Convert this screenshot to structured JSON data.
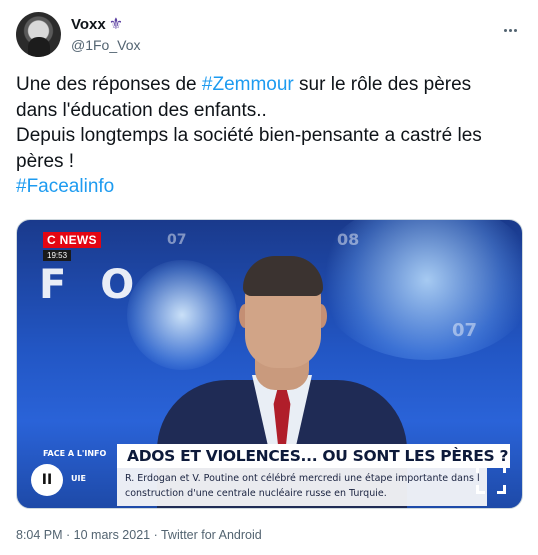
{
  "author": {
    "display_name": "Voxx",
    "badge_glyph": "⚜",
    "handle": "@1Fo_Vox",
    "avatar_icon": "profile-avatar"
  },
  "more_icon": "more-horizontal-icon",
  "tweet": {
    "line1_prefix": "Une des réponses de ",
    "line1_hashtag": "#Zemmour",
    "line1_suffix": " sur le rôle des pères",
    "line2": "dans l'éducation des enfants..",
    "line3": "Depuis longtemps la société bien-pensante a castré les",
    "line4": "pères !",
    "line5_hashtag": "#Facealinfo"
  },
  "media": {
    "channel_logo": "C NEWS",
    "clock": "19:53",
    "bg_text": "F O",
    "bg_numbers": [
      "07",
      "08",
      "07"
    ],
    "show_label": "FACE A L'INFO",
    "badge_glyph": "II",
    "show_label2": "UIE",
    "headline": "ADOS ET VIOLENCES... OU SONT LES PÈRES ?",
    "ticker_line1": "R. Erdogan et V. Poutine ont célébré mercredi une étape importante dans l",
    "ticker_line2": "construction d'une centrale nucléaire russe en Turquie.",
    "expand_icon": "expand-video-icon"
  },
  "meta": {
    "text": "8:04 PM · 10 mars 2021 · Twitter for Android"
  },
  "colors": {
    "hashtag": "#1d9bf0",
    "secondary_text": "#536471",
    "cnews_red": "#e30613"
  }
}
